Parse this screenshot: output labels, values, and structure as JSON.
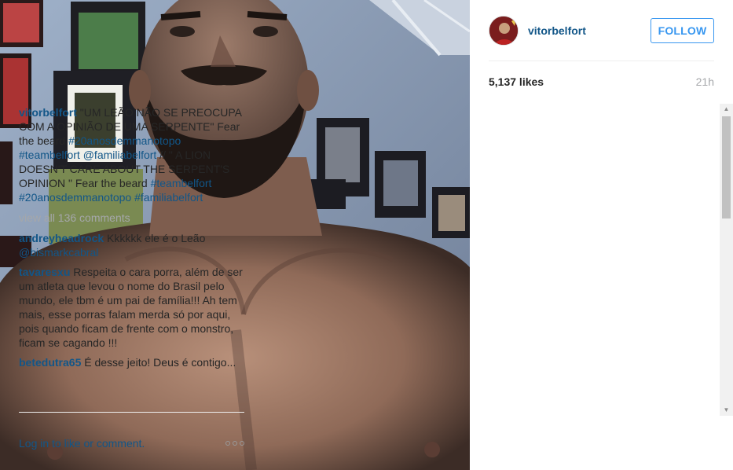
{
  "post": {
    "photo_icon": "photo-placeholder",
    "author": "vitorbelfort",
    "follow_label": "FOLLOW",
    "likes": "5,137 likes",
    "time": "21h"
  },
  "caption": {
    "user": "vitorbelfort",
    "part1": "\"UM LEÃO NÃO SE PREOCUPA COM A OPINIÃO DE UMA SERPENTE\" Fear the beard ",
    "tag1": "#20anosdemmanotopo",
    "sp1": " ",
    "tag2": "#teambelfort",
    "sp2": " ",
    "tag3": "@familiabelfort",
    "part2": " // \" A LION DOESN'T CARE ABOUT THE SERPENT'S OPINION \" Fear the beard ",
    "tag4": "#teambelfort",
    "sp3": " ",
    "tag5": "#20anosdemmanotopo",
    "sp4": " ",
    "tag6": "#familiabelfort"
  },
  "view_all": "view all 136 comments",
  "comments": [
    {
      "user": "andreyheadrock",
      "text": " Kkkkkk ele é o Leão ",
      "tag": "@bismarkcabral"
    },
    {
      "user": "tavaresxu",
      "text": " Respeita o cara porra, além de ser um atleta que levou o nome do Brasil pelo mundo, ele tbm é um pai de família!!! Ah tem mais, esse porras falam merda só por aqui, pois quando ficam de frente com o monstro, ficam se cagando !!!"
    },
    {
      "user": "betedutra65",
      "text": " É desse jeito! Deus é contigo..."
    }
  ],
  "footer": {
    "login_text": "Log in to like or comment.",
    "more_icon": "ellipsis-icon"
  },
  "scrollbar": {
    "up_arrow": "▲",
    "down_arrow": "▼"
  },
  "colors": {
    "link": "#125688",
    "follow": "#3897f0",
    "muted": "#a5a7aa",
    "text": "#262626"
  }
}
